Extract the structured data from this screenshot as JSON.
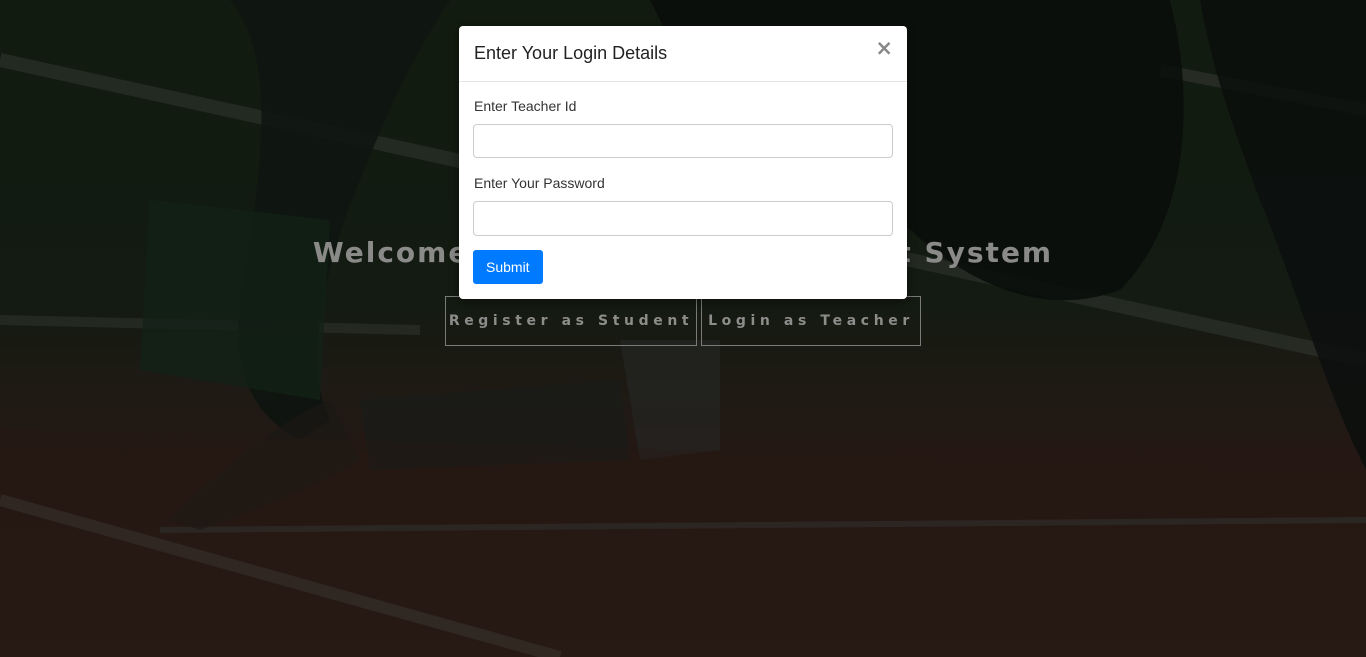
{
  "hero": {
    "title_left": "Welcome",
    "title_right": "t System",
    "buttons": [
      {
        "label": "Register as Student"
      },
      {
        "label": "Login as Teacher"
      }
    ]
  },
  "modal": {
    "title": "Enter Your Login Details",
    "close_symbol": "×",
    "fields": [
      {
        "label": "Enter Teacher Id",
        "value": "",
        "placeholder": ""
      },
      {
        "label": "Enter Your Password",
        "value": "",
        "placeholder": ""
      }
    ],
    "submit_label": "Submit"
  },
  "colors": {
    "primary": "#007bff",
    "overlay": "#000000"
  },
  "icons": {
    "close": "close-icon"
  }
}
